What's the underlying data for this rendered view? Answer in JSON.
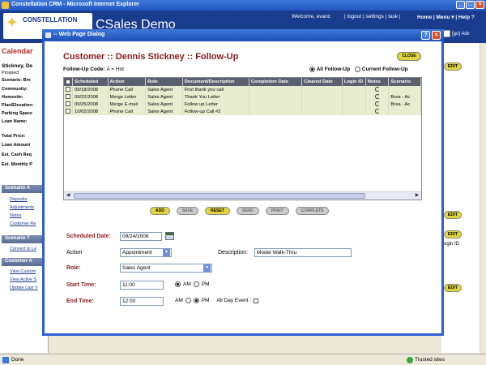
{
  "browser": {
    "title": "Constellation CRM - Microsoft Internet Explorer",
    "status": "Done",
    "zone": "Trusted sites"
  },
  "crm": {
    "logo_text": "CONSTELLATION",
    "app_title": "CSales Demo",
    "welcome": "Welcome, evanc",
    "links": "| logout | settings | task |",
    "nav": "Home | Menu ▾ | Help ?",
    "go_label": "[go] Adv"
  },
  "left": {
    "calendar": "Calendar",
    "name": "Stickney, De",
    "type": "Prospect",
    "scenario": "Scenario: Bre",
    "fields": [
      "Community:",
      "Homesite:",
      "Plan/Elevation:",
      "Parking Space",
      "Loan Name:"
    ],
    "fields2": [
      "Total Price:",
      "Loan Amount",
      "Est. Cash Req",
      "Est. Monthly P"
    ],
    "section1": "Scenario A",
    "links1": [
      "Deposits",
      "Adjustments",
      "Notes",
      "Customer Re"
    ],
    "section2": "Scenario T",
    "links2": [
      "Convert to Le"
    ],
    "section3": "Customer A",
    "links3": [
      "View Custom",
      "View Active S",
      "Update Last V"
    ]
  },
  "right": {
    "edit": "EDIT",
    "login_id": "ogin ID"
  },
  "dialog": {
    "title": "-- Web Page Dialog",
    "heading": "Customer ::  Dennis Stickney :: Follow-Up",
    "close": "CLOSE",
    "code_label": "Follow-Up Code:",
    "code_value": "A = Hot",
    "filter_all": "All Follow-Up",
    "filter_current": "Current Follow-Up",
    "columns": [
      "",
      "Scheduled",
      "Action",
      "Role",
      "Document/Description",
      "Completion Date",
      "Cleared Date",
      "Login ID",
      "Notes",
      "Scenario"
    ],
    "rows": [
      {
        "scheduled": "09/18/2008",
        "action": "Phone Call",
        "role": "Sales Agent",
        "desc": "First thank you call",
        "completion": "",
        "cleared": "",
        "login": "",
        "scenario": ""
      },
      {
        "scheduled": "09/22/2008",
        "action": "Merge Letter",
        "role": "Sales Agent",
        "desc": "Thank You Letter",
        "completion": "",
        "cleared": "",
        "login": "",
        "scenario": "Brea - Ac"
      },
      {
        "scheduled": "09/25/2008",
        "action": "Merge E-mail",
        "role": "Sales Agent",
        "desc": "Follow up Letter",
        "completion": "",
        "cleared": "",
        "login": "",
        "scenario": "Brea - Ac"
      },
      {
        "scheduled": "10/02/2008",
        "action": "Phone Call",
        "role": "Sales Agent",
        "desc": "Follow-up Call #2",
        "completion": "",
        "cleared": "",
        "login": "",
        "scenario": ""
      }
    ],
    "buttons": [
      "ADD",
      "SAVE",
      "RESET",
      "SEND",
      "PRINT",
      "COMPLETE"
    ],
    "form": {
      "scheduled_label": "Scheduled Date:",
      "scheduled_value": "09/24/2008",
      "action_label": "Action",
      "action_value": "Appointment",
      "description_label": "Description:",
      "description_value": "Model Walk-Thru",
      "role_label": "Role:",
      "role_value": "Sales Agent",
      "start_label": "Start Time:",
      "start_value": "11:00",
      "end_label": "End Time:",
      "end_value": "12:00",
      "am": "AM",
      "pm": "PM",
      "allday_label": "All Day Event :"
    }
  }
}
